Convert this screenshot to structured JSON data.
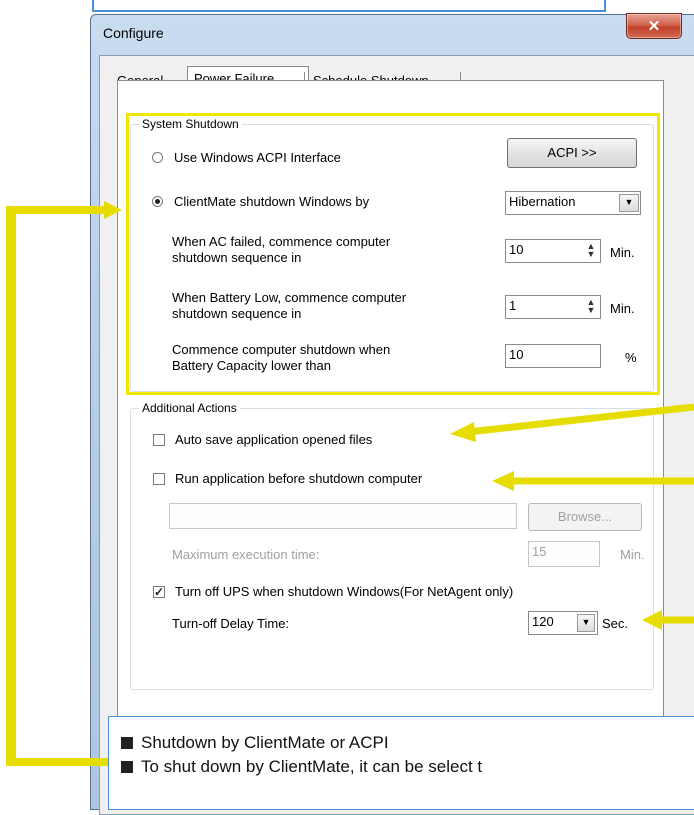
{
  "window": {
    "title": "Configure",
    "close_glyph": "✕"
  },
  "tabs": [
    {
      "label": "General"
    },
    {
      "label": "Power Failure"
    },
    {
      "label": "Schedule Shutdown"
    }
  ],
  "system_shutdown": {
    "group_label": "System Shutdown",
    "acpi_radio_label": "Use Windows ACPI Interface",
    "acpi_button_label": "ACPI >>",
    "clientmate_radio_label": "ClientMate shutdown Windows by",
    "mode_selected": "Hibernation",
    "ac_failed_label_1": "When AC failed, commence computer",
    "ac_failed_label_2": "shutdown sequence in",
    "ac_failed_value": "10",
    "ac_failed_unit": "Min.",
    "battery_low_label_1": "When Battery Low, commence computer",
    "battery_low_label_2": "shutdown sequence in",
    "battery_low_value": "1",
    "battery_low_unit": "Min.",
    "capacity_label_1": "Commence computer shutdown when",
    "capacity_label_2": "Battery Capacity lower than",
    "capacity_value": "10",
    "capacity_unit": "%"
  },
  "additional_actions": {
    "group_label": "Additional Actions",
    "auto_save_label": "Auto save application opened files",
    "run_app_label": "Run application before shutdown computer",
    "run_app_path": "",
    "browse_label": "Browse...",
    "max_exec_label": "Maximum execution time:",
    "max_exec_value": "15",
    "max_exec_unit": "Min.",
    "turn_off_ups_label": "Turn off UPS when shutdown Windows(For NetAgent only)",
    "turn_off_delay_label": "Turn-off Delay Time:",
    "turn_off_delay_value": "120",
    "turn_off_delay_unit": "Sec."
  },
  "note": {
    "line1": "Shutdown by ClientMate or ACPI",
    "line2": "To shut down by ClientMate, it can be select t"
  },
  "colors": {
    "highlight_yellow": "#f2e600",
    "callout_blue": "#4a90d9"
  }
}
